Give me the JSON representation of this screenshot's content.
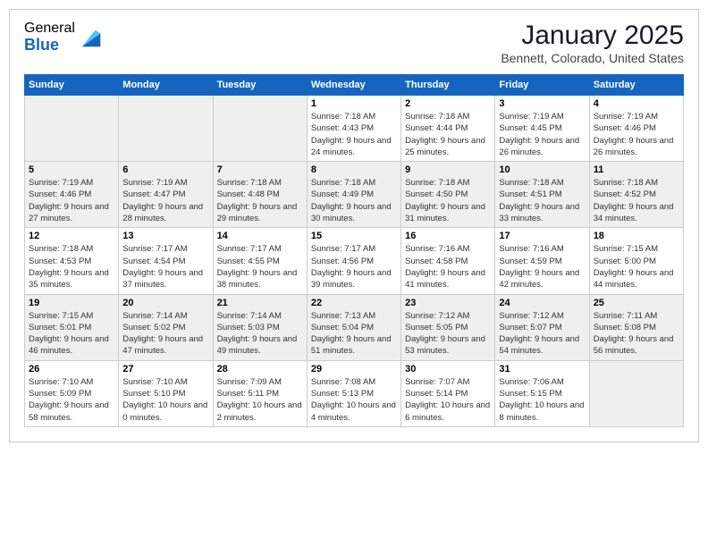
{
  "logo": {
    "general": "General",
    "blue": "Blue"
  },
  "header": {
    "month": "January 2025",
    "location": "Bennett, Colorado, United States"
  },
  "weekdays": [
    "Sunday",
    "Monday",
    "Tuesday",
    "Wednesday",
    "Thursday",
    "Friday",
    "Saturday"
  ],
  "weeks": [
    [
      {
        "day": "",
        "info": ""
      },
      {
        "day": "",
        "info": ""
      },
      {
        "day": "",
        "info": ""
      },
      {
        "day": "1",
        "info": "Sunrise: 7:18 AM\nSunset: 4:43 PM\nDaylight: 9 hours and 24 minutes."
      },
      {
        "day": "2",
        "info": "Sunrise: 7:18 AM\nSunset: 4:44 PM\nDaylight: 9 hours and 25 minutes."
      },
      {
        "day": "3",
        "info": "Sunrise: 7:19 AM\nSunset: 4:45 PM\nDaylight: 9 hours and 26 minutes."
      },
      {
        "day": "4",
        "info": "Sunrise: 7:19 AM\nSunset: 4:46 PM\nDaylight: 9 hours and 26 minutes."
      }
    ],
    [
      {
        "day": "5",
        "info": "Sunrise: 7:19 AM\nSunset: 4:46 PM\nDaylight: 9 hours and 27 minutes."
      },
      {
        "day": "6",
        "info": "Sunrise: 7:19 AM\nSunset: 4:47 PM\nDaylight: 9 hours and 28 minutes."
      },
      {
        "day": "7",
        "info": "Sunrise: 7:18 AM\nSunset: 4:48 PM\nDaylight: 9 hours and 29 minutes."
      },
      {
        "day": "8",
        "info": "Sunrise: 7:18 AM\nSunset: 4:49 PM\nDaylight: 9 hours and 30 minutes."
      },
      {
        "day": "9",
        "info": "Sunrise: 7:18 AM\nSunset: 4:50 PM\nDaylight: 9 hours and 31 minutes."
      },
      {
        "day": "10",
        "info": "Sunrise: 7:18 AM\nSunset: 4:51 PM\nDaylight: 9 hours and 33 minutes."
      },
      {
        "day": "11",
        "info": "Sunrise: 7:18 AM\nSunset: 4:52 PM\nDaylight: 9 hours and 34 minutes."
      }
    ],
    [
      {
        "day": "12",
        "info": "Sunrise: 7:18 AM\nSunset: 4:53 PM\nDaylight: 9 hours and 35 minutes."
      },
      {
        "day": "13",
        "info": "Sunrise: 7:17 AM\nSunset: 4:54 PM\nDaylight: 9 hours and 37 minutes."
      },
      {
        "day": "14",
        "info": "Sunrise: 7:17 AM\nSunset: 4:55 PM\nDaylight: 9 hours and 38 minutes."
      },
      {
        "day": "15",
        "info": "Sunrise: 7:17 AM\nSunset: 4:56 PM\nDaylight: 9 hours and 39 minutes."
      },
      {
        "day": "16",
        "info": "Sunrise: 7:16 AM\nSunset: 4:58 PM\nDaylight: 9 hours and 41 minutes."
      },
      {
        "day": "17",
        "info": "Sunrise: 7:16 AM\nSunset: 4:59 PM\nDaylight: 9 hours and 42 minutes."
      },
      {
        "day": "18",
        "info": "Sunrise: 7:15 AM\nSunset: 5:00 PM\nDaylight: 9 hours and 44 minutes."
      }
    ],
    [
      {
        "day": "19",
        "info": "Sunrise: 7:15 AM\nSunset: 5:01 PM\nDaylight: 9 hours and 46 minutes."
      },
      {
        "day": "20",
        "info": "Sunrise: 7:14 AM\nSunset: 5:02 PM\nDaylight: 9 hours and 47 minutes."
      },
      {
        "day": "21",
        "info": "Sunrise: 7:14 AM\nSunset: 5:03 PM\nDaylight: 9 hours and 49 minutes."
      },
      {
        "day": "22",
        "info": "Sunrise: 7:13 AM\nSunset: 5:04 PM\nDaylight: 9 hours and 51 minutes."
      },
      {
        "day": "23",
        "info": "Sunrise: 7:12 AM\nSunset: 5:05 PM\nDaylight: 9 hours and 53 minutes."
      },
      {
        "day": "24",
        "info": "Sunrise: 7:12 AM\nSunset: 5:07 PM\nDaylight: 9 hours and 54 minutes."
      },
      {
        "day": "25",
        "info": "Sunrise: 7:11 AM\nSunset: 5:08 PM\nDaylight: 9 hours and 56 minutes."
      }
    ],
    [
      {
        "day": "26",
        "info": "Sunrise: 7:10 AM\nSunset: 5:09 PM\nDaylight: 9 hours and 58 minutes."
      },
      {
        "day": "27",
        "info": "Sunrise: 7:10 AM\nSunset: 5:10 PM\nDaylight: 10 hours and 0 minutes."
      },
      {
        "day": "28",
        "info": "Sunrise: 7:09 AM\nSunset: 5:11 PM\nDaylight: 10 hours and 2 minutes."
      },
      {
        "day": "29",
        "info": "Sunrise: 7:08 AM\nSunset: 5:13 PM\nDaylight: 10 hours and 4 minutes."
      },
      {
        "day": "30",
        "info": "Sunrise: 7:07 AM\nSunset: 5:14 PM\nDaylight: 10 hours and 6 minutes."
      },
      {
        "day": "31",
        "info": "Sunrise: 7:06 AM\nSunset: 5:15 PM\nDaylight: 10 hours and 8 minutes."
      },
      {
        "day": "",
        "info": ""
      }
    ]
  ]
}
